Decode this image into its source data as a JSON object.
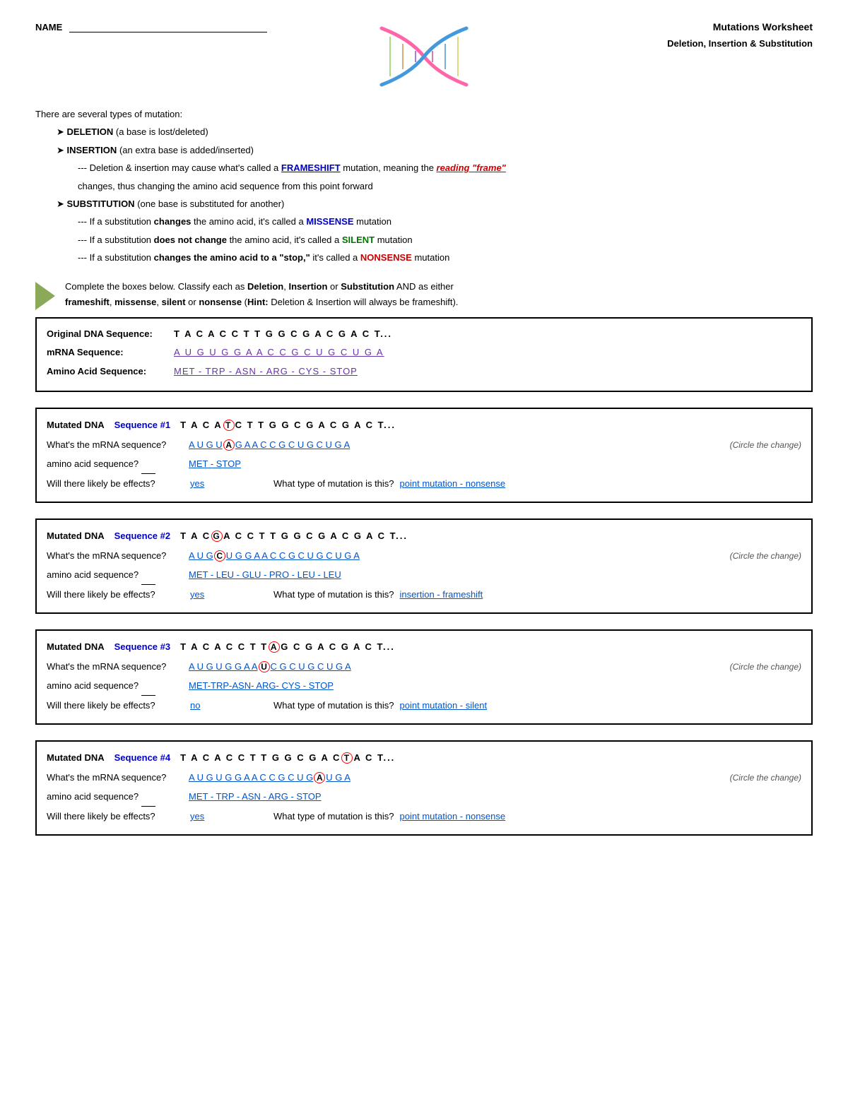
{
  "header": {
    "name_label": "NAME",
    "title": "Mutations Worksheet",
    "subtitle": "Deletion, Insertion & Substitution"
  },
  "intro": {
    "line1": "There are several types of mutation:",
    "deletion_label": "DELETION",
    "deletion_desc": "(a base is lost/deleted)",
    "insertion_label": "INSERTION",
    "insertion_desc": "(an extra base is added/inserted)",
    "frameshift_note1": "--- Deletion & insertion may cause what's called a ",
    "frameshift_word": "FRAMESHIFT",
    "frameshift_note2": " mutation, meaning the ",
    "reading_frame_word": "reading \"frame\"",
    "frameshift_note3": " changes, thus changing the amino acid sequence from this point forward",
    "substitution_label": "SUBSTITUTION",
    "substitution_desc": "(one base is substituted for another)",
    "sub1_before": "--- If a substitution ",
    "sub1_bold": "changes",
    "sub1_after": " the amino acid, it's called a ",
    "missense_word": "MISSENSE",
    "sub1_end": " mutation",
    "sub2_before": "--- If a substitution ",
    "sub2_bold": "does not change",
    "sub2_after": " the amino acid, it's called a ",
    "silent_word": "SILENT",
    "sub2_end": " mutation",
    "sub3_before": "--- If a substitution ",
    "sub3_bold": "changes the amino acid to a \"stop,\"",
    "sub3_after": " it's called a ",
    "nonsense_word": "NONSENSE",
    "sub3_end": " mutation"
  },
  "instruction": {
    "text1": "Complete the boxes below.  Classify each as ",
    "bold_parts": [
      "Deletion",
      "Insertion",
      "Substitution",
      "frameshift",
      "missense",
      "silent",
      "nonsense"
    ],
    "text2": " AND as either",
    "text3": " or ",
    "hint": "Hint:",
    "hint_desc": " Deletion & Insertion will always be frameshift)."
  },
  "original": {
    "dna_label": "Original DNA Sequence:",
    "dna_seq": "T A C A C C T T G G C G A C G A C T...",
    "mrna_label": "mRNA Sequence:",
    "mrna_seq": "A U G U G G A A C C G C U G C U G A",
    "amino_label": "Amino Acid Sequence:",
    "amino_seq": "MET - TRP - ASN - ARG - CYS - STOP"
  },
  "mutation1": {
    "label": "Mutated DNA",
    "seq_label": "Sequence #1",
    "dna_parts": [
      "T A C A",
      "T",
      "C T T G G C G A C G A C T..."
    ],
    "circled_letter": "T",
    "mrna_label": "What's the mRNA sequence?",
    "mrna_parts": [
      "A U G U",
      "A",
      "G A A C C G C U G C U G A"
    ],
    "mrna_circled": "A",
    "circle_note": "(Circle the change)",
    "amino_label": "amino acid sequence?",
    "amino_answer": "MET - STOP",
    "effects_label": "Will there likely be effects?",
    "effects_answer": "yes",
    "type_label": "What type of mutation is this?",
    "type_answer": "point mutation - nonsense"
  },
  "mutation2": {
    "label": "Mutated DNA",
    "seq_label": "Sequence #2",
    "dna_parts": [
      "T A C",
      "G",
      "A C C T T G G C G A C G A C T..."
    ],
    "circled_letter": "G",
    "mrna_label": "What's the mRNA sequence?",
    "mrna_parts": [
      "A U G",
      "C",
      "U G G A A C C G C U G C U G A"
    ],
    "mrna_circled": "C",
    "circle_note": "(Circle the change)",
    "amino_label": "amino acid sequence?",
    "amino_answer": "MET - LEU - GLU - PRO - LEU - LEU",
    "effects_label": "Will there likely be effects?",
    "effects_answer": "yes",
    "type_label": "What type of mutation is this?",
    "type_answer": "insertion - frameshift"
  },
  "mutation3": {
    "label": "Mutated DNA",
    "seq_label": "Sequence #3",
    "dna_parts": [
      "T A C A C C T T",
      "A",
      "G C G A C G A C T..."
    ],
    "circled_letter": "A",
    "mrna_label": "What's the mRNA sequence?",
    "mrna_parts": [
      "A U G U G G A A",
      "U",
      "C G C U G C U G A"
    ],
    "mrna_circled": "U",
    "circle_note": "(Circle the change)",
    "amino_label": "amino acid sequence?",
    "amino_answer": "MET-TRP-ASN- ARG- CYS - STOP",
    "effects_label": "Will there likely be effects?",
    "effects_answer": "no",
    "type_label": "What type of mutation is this?",
    "type_answer": "point mutation - silent"
  },
  "mutation4": {
    "label": "Mutated DNA",
    "seq_label": "Sequence #4",
    "dna_parts": [
      "T A C A C C T T G G C G A C",
      "T",
      "A C T..."
    ],
    "circled_letter": "T",
    "mrna_label": "What's the mRNA sequence?",
    "mrna_parts": [
      "A U G U G G A A C C G C U G",
      "A",
      "U G A"
    ],
    "mrna_circled": "A",
    "circle_note": "(Circle the change)",
    "amino_label": "amino acid sequence?",
    "amino_answer": "MET - TRP - ASN - ARG - STOP",
    "effects_label": "Will there likely be effects?",
    "effects_answer": "yes",
    "type_label": "What type of mutation is this?",
    "type_answer": "point mutation - nonsense"
  }
}
